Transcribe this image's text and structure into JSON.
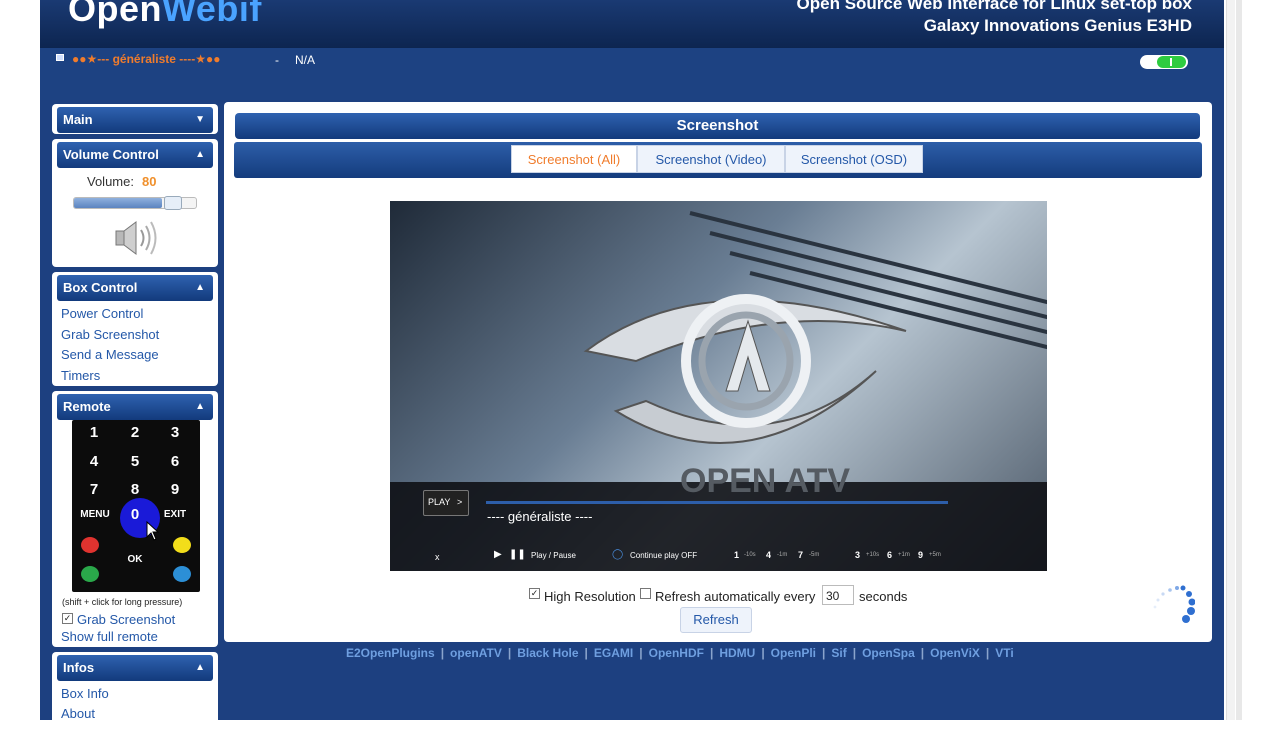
{
  "header": {
    "logo_part1": "Open",
    "logo_part2": "Webif",
    "tagline1": "Open Source Web Interface for Linux set-top box",
    "tagline2": "Galaxy Innovations Genius E3HD"
  },
  "status": {
    "channel": "●●★--- généraliste ----★●●",
    "separator": "-",
    "program": "N/A"
  },
  "sidebar": {
    "main": {
      "title": "Main"
    },
    "volume": {
      "title": "Volume Control",
      "label": "Volume:",
      "value": "80",
      "level_percent": 80
    },
    "box_control": {
      "title": "Box Control",
      "items": [
        "Power Control",
        "Grab Screenshot",
        "Send a Message",
        "Timers"
      ]
    },
    "remote": {
      "title": "Remote",
      "keys": [
        "1",
        "2",
        "3",
        "4",
        "5",
        "6",
        "7",
        "8",
        "9",
        "MENU",
        "0",
        "EXIT",
        "OK"
      ],
      "hint": "(shift + click for long pressure)",
      "grab_screenshot_label": "Grab Screenshot",
      "show_full_remote": "Show full remote"
    },
    "infos": {
      "title": "Infos",
      "items": [
        "Box Info",
        "About"
      ]
    }
  },
  "main": {
    "title": "Screenshot",
    "tabs": [
      {
        "label": "Screenshot (All)",
        "active": true
      },
      {
        "label": "Screenshot (Video)",
        "active": false
      },
      {
        "label": "Screenshot (OSD)",
        "active": false
      }
    ],
    "osd": {
      "play_label": "PLAY",
      "channel_name": "---- généraliste ----",
      "x_label": "x",
      "play_pause": "Play / Pause",
      "continue_play": "Continue play OFF",
      "skip_1": "1",
      "skip_1_label": "-10s",
      "skip_4": "4",
      "skip_4_label": "-1m",
      "skip_7": "7",
      "skip_7_label": "-5m",
      "skip_3": "3",
      "skip_3_label": "+10s",
      "skip_6": "6",
      "skip_6_label": "+1m",
      "skip_9": "9",
      "skip_9_label": "+5m",
      "watermark": "OPEN ATV"
    },
    "options": {
      "high_resolution_label": "High Resolution",
      "high_resolution_checked": true,
      "auto_refresh_label": "Refresh automatically every",
      "auto_refresh_checked": false,
      "interval_value": "30",
      "seconds_label": "seconds",
      "refresh_button": "Refresh"
    }
  },
  "footer": {
    "links": [
      "E2OpenPlugins",
      "openATV",
      "Black Hole",
      "EGAMI",
      "OpenHDF",
      "HDMU",
      "OpenPli",
      "Sif",
      "OpenSpa",
      "OpenViX",
      "VTi"
    ]
  },
  "colors": {
    "page_bg": "#1d4080",
    "header_blue": "#1a3a73",
    "accent_orange": "#f07c2c",
    "link_blue": "#2458a8",
    "toggle_green": "#2ecc40"
  }
}
